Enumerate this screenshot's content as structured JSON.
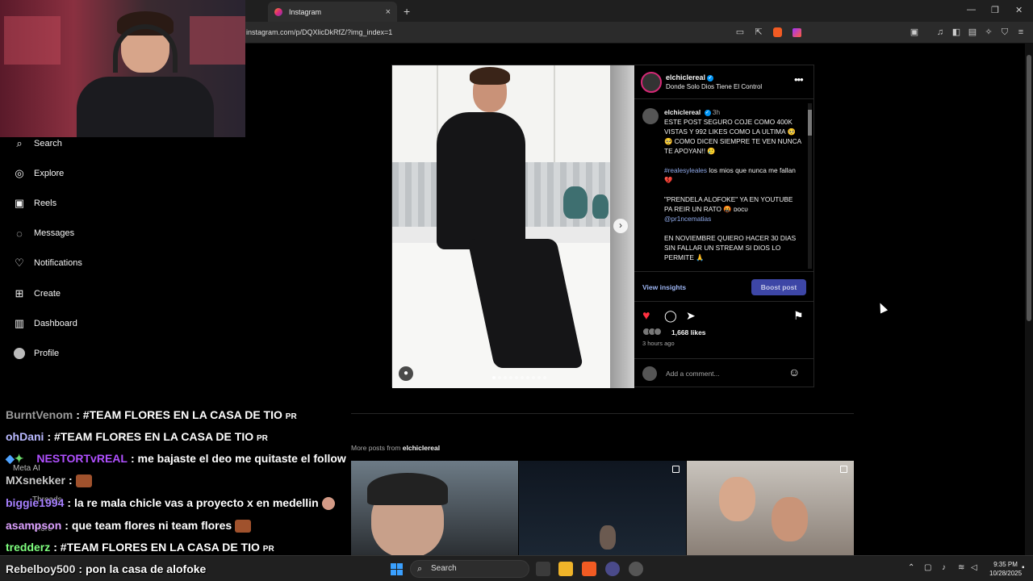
{
  "browser": {
    "tab_title": "Instagram",
    "tab_close": "×",
    "new_tab": "+",
    "url": "instagram.com/p/DQXlicDkRfZ/?img_index=1",
    "window_controls": [
      "—",
      "❐",
      "✕"
    ]
  },
  "sidebar": {
    "items": [
      {
        "label": "Search",
        "icon": "search-icon"
      },
      {
        "label": "Explore",
        "icon": "compass-icon"
      },
      {
        "label": "Reels",
        "icon": "reels-icon"
      },
      {
        "label": "Messages",
        "icon": "messenger-icon"
      },
      {
        "label": "Notifications",
        "icon": "heart-icon"
      },
      {
        "label": "Create",
        "icon": "plus-square-icon"
      },
      {
        "label": "Dashboard",
        "icon": "chart-icon"
      },
      {
        "label": "Profile",
        "icon": "avatar-icon"
      }
    ],
    "meta_ai": "Meta AI",
    "threads": "Threads",
    "more": "More"
  },
  "post": {
    "username": "elchiclereal",
    "location": "Donde Solo Dios Tiene El Control",
    "more": "•••",
    "caption_user": "elchiclereal",
    "caption_time": "3h",
    "caption_1": "ESTE POST SEGURO COJE COMO 400K VISTAS Y 992 LIKES COMO LA ULTIMA 🥺🥺 COMO DICEN SIEMPRE TE VEN NUNCA TE APOYAN!! 🥲",
    "caption_2_tag": "#realesyleales",
    "caption_2_rest": " los mios que nunca me fallan 💔",
    "caption_3": "\"PRENDELA ALOFOKE\" YA EN YOUTUBE PA REIR UN RATO 🤬 ᴅᴏᴄᴜ",
    "caption_3_mention": "@pr1ncematias",
    "caption_4": "EN NOVIEMBRE QUIERO HACER 30 DIAS SIN FALLAR UN STREAM SI DIOS LO PERMITE 🙏",
    "view_insights": "View insights",
    "boost_post": "Boost post",
    "likes": "1,668 likes",
    "time_ago": "3 hours ago",
    "add_comment_placeholder": "Add a comment...",
    "next_arrow": "›",
    "carousel_count": 10,
    "carousel_index": 1
  },
  "more_posts": {
    "prefix": "More posts from ",
    "user": "elchiclereal"
  },
  "chat": [
    {
      "user": "BurntVenom",
      "color": "#9a9a9a",
      "msg": "#TEAM FLORES EN LA CASA DE TIO",
      "badge": "PR"
    },
    {
      "user": "ohDani",
      "color": "#b9b9ff",
      "msg": "#TEAM FLORES EN LA CASA DE TIO",
      "badge": "PR"
    },
    {
      "user": "NESTORTvREAL",
      "color": "#b050ff",
      "msg": "me bajaste el deo me quitaste el follow",
      "badge": ""
    },
    {
      "user": "MXsnekker",
      "color": "#c8c8c8",
      "msg": "",
      "badge": ""
    },
    {
      "user": "biggie1994",
      "color": "#a780ff",
      "msg": "la re mala chicle vas a proyecto x en medellin",
      "badge": ""
    },
    {
      "user": "asampson",
      "color": "#dca0ff",
      "msg": "que team flores ni team flores",
      "badge": ""
    },
    {
      "user": "tredderz",
      "color": "#7fff7f",
      "msg": "#TEAM FLORES EN LA CASA DE TIO",
      "badge": "PR"
    },
    {
      "user": "Rebelboy500",
      "color": "#e8e8e8",
      "msg": "pon la casa de alofoke",
      "badge": ""
    }
  ],
  "taskbar": {
    "search": "Search",
    "time": "9:35 PM",
    "date": "10/28/2025"
  }
}
